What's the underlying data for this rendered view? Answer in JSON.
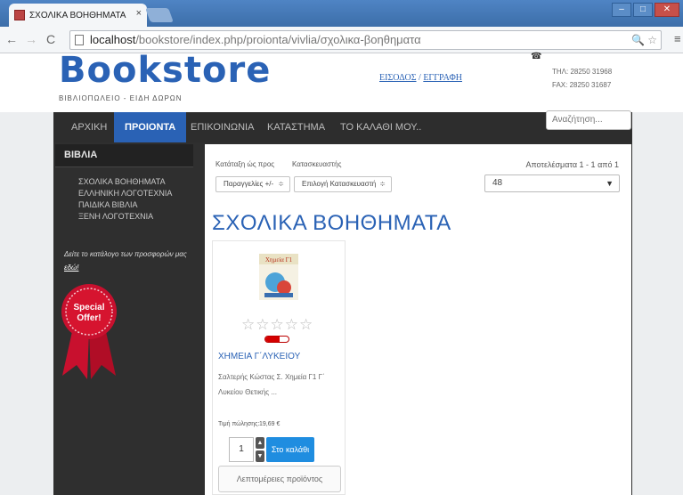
{
  "browser": {
    "tab_title": "ΣΧΟΛΙΚΑ ΒΟΗΘΗΜΑΤΑ",
    "tab_close": "×",
    "url_host": "localhost",
    "url_rest": "/bookstore/index.php/proionta/vivlia/σχολικα-βοηθηματα",
    "win_min": "‒",
    "win_max": "□",
    "win_close": "✕"
  },
  "header": {
    "logo": "Bookstore",
    "tagline": "ΒΙΒΛΙΟΠΩΛΕΙΟ - ΕΙΔΗ ΔΩΡΩΝ",
    "login": "ΕΙΣΟΔΟΣ",
    "separator": " / ",
    "register": "ΕΓΓΡΑΦΗ",
    "tel": "ΤΗΛ: 28250 31968",
    "fax": "FAX: 28250 31687"
  },
  "menu": {
    "items": [
      {
        "label": "ΑΡΧΙΚΗ"
      },
      {
        "label": "ΠΡΟΙΟΝΤΑ"
      },
      {
        "label": "ΕΠΙΚΟΙΝΩΝΙΑ"
      },
      {
        "label": "ΚΑΤΑΣΤΗΜΑ"
      },
      {
        "label": "ΤΟ ΚΑΛΑΘΙ ΜΟΥ.."
      }
    ],
    "search_placeholder": "Αναζήτηση..."
  },
  "sidebar": {
    "heading": "ΒΙΒΛΙΑ",
    "items": [
      {
        "label": "ΣΧΟΛΙΚΑ ΒΟΗΘΗΜΑΤΑ"
      },
      {
        "label": "ΕΛΛΗΝΙΚΗ ΛΟΓΟΤΕΧΝΙΑ"
      },
      {
        "label": "ΠΑΙΔΙΚΑ ΒΙΒΛΙΑ"
      },
      {
        "label": "ΞΕΝΗ ΛΟΓΟΤΕΧΝΙΑ"
      }
    ],
    "catalog_text": "Δείτε το κατάλογο των προσφορών μας ",
    "catalog_link": "εδώ!",
    "badge_line1": "Special",
    "badge_line2": "Offer!"
  },
  "main": {
    "sort_label": "Κατάταξη ώς προς",
    "sort_value": "Παραγγελίες +/-",
    "manufacturer_label": "Κατασκευαστής",
    "manufacturer_value": "Επιλογή Κατασκευαστή",
    "results": "Αποτελέσματα 1 - 1 από 1",
    "per_page": "48",
    "category_title": "ΣΧΟΛΙΚΑ ΒΟΗΘΗΜΑΤΑ",
    "product": {
      "name": "ΧΗΜΕΙΑ Γ΄ΛΥΚΕΙΟΥ",
      "description": "Σαλτερής Κώστας Σ. Χημεία Γ1 Γ΄ Λυκείου Θετικής ...",
      "price_label": "Τιμή πώλησης:",
      "price": "19,69 €",
      "quantity": "1",
      "add_to_cart": "Στο καλάθι",
      "details": "Λεπτομέρειες προϊόντος",
      "rating_stars": "☆☆☆☆☆",
      "stock_level": 0.6
    }
  }
}
